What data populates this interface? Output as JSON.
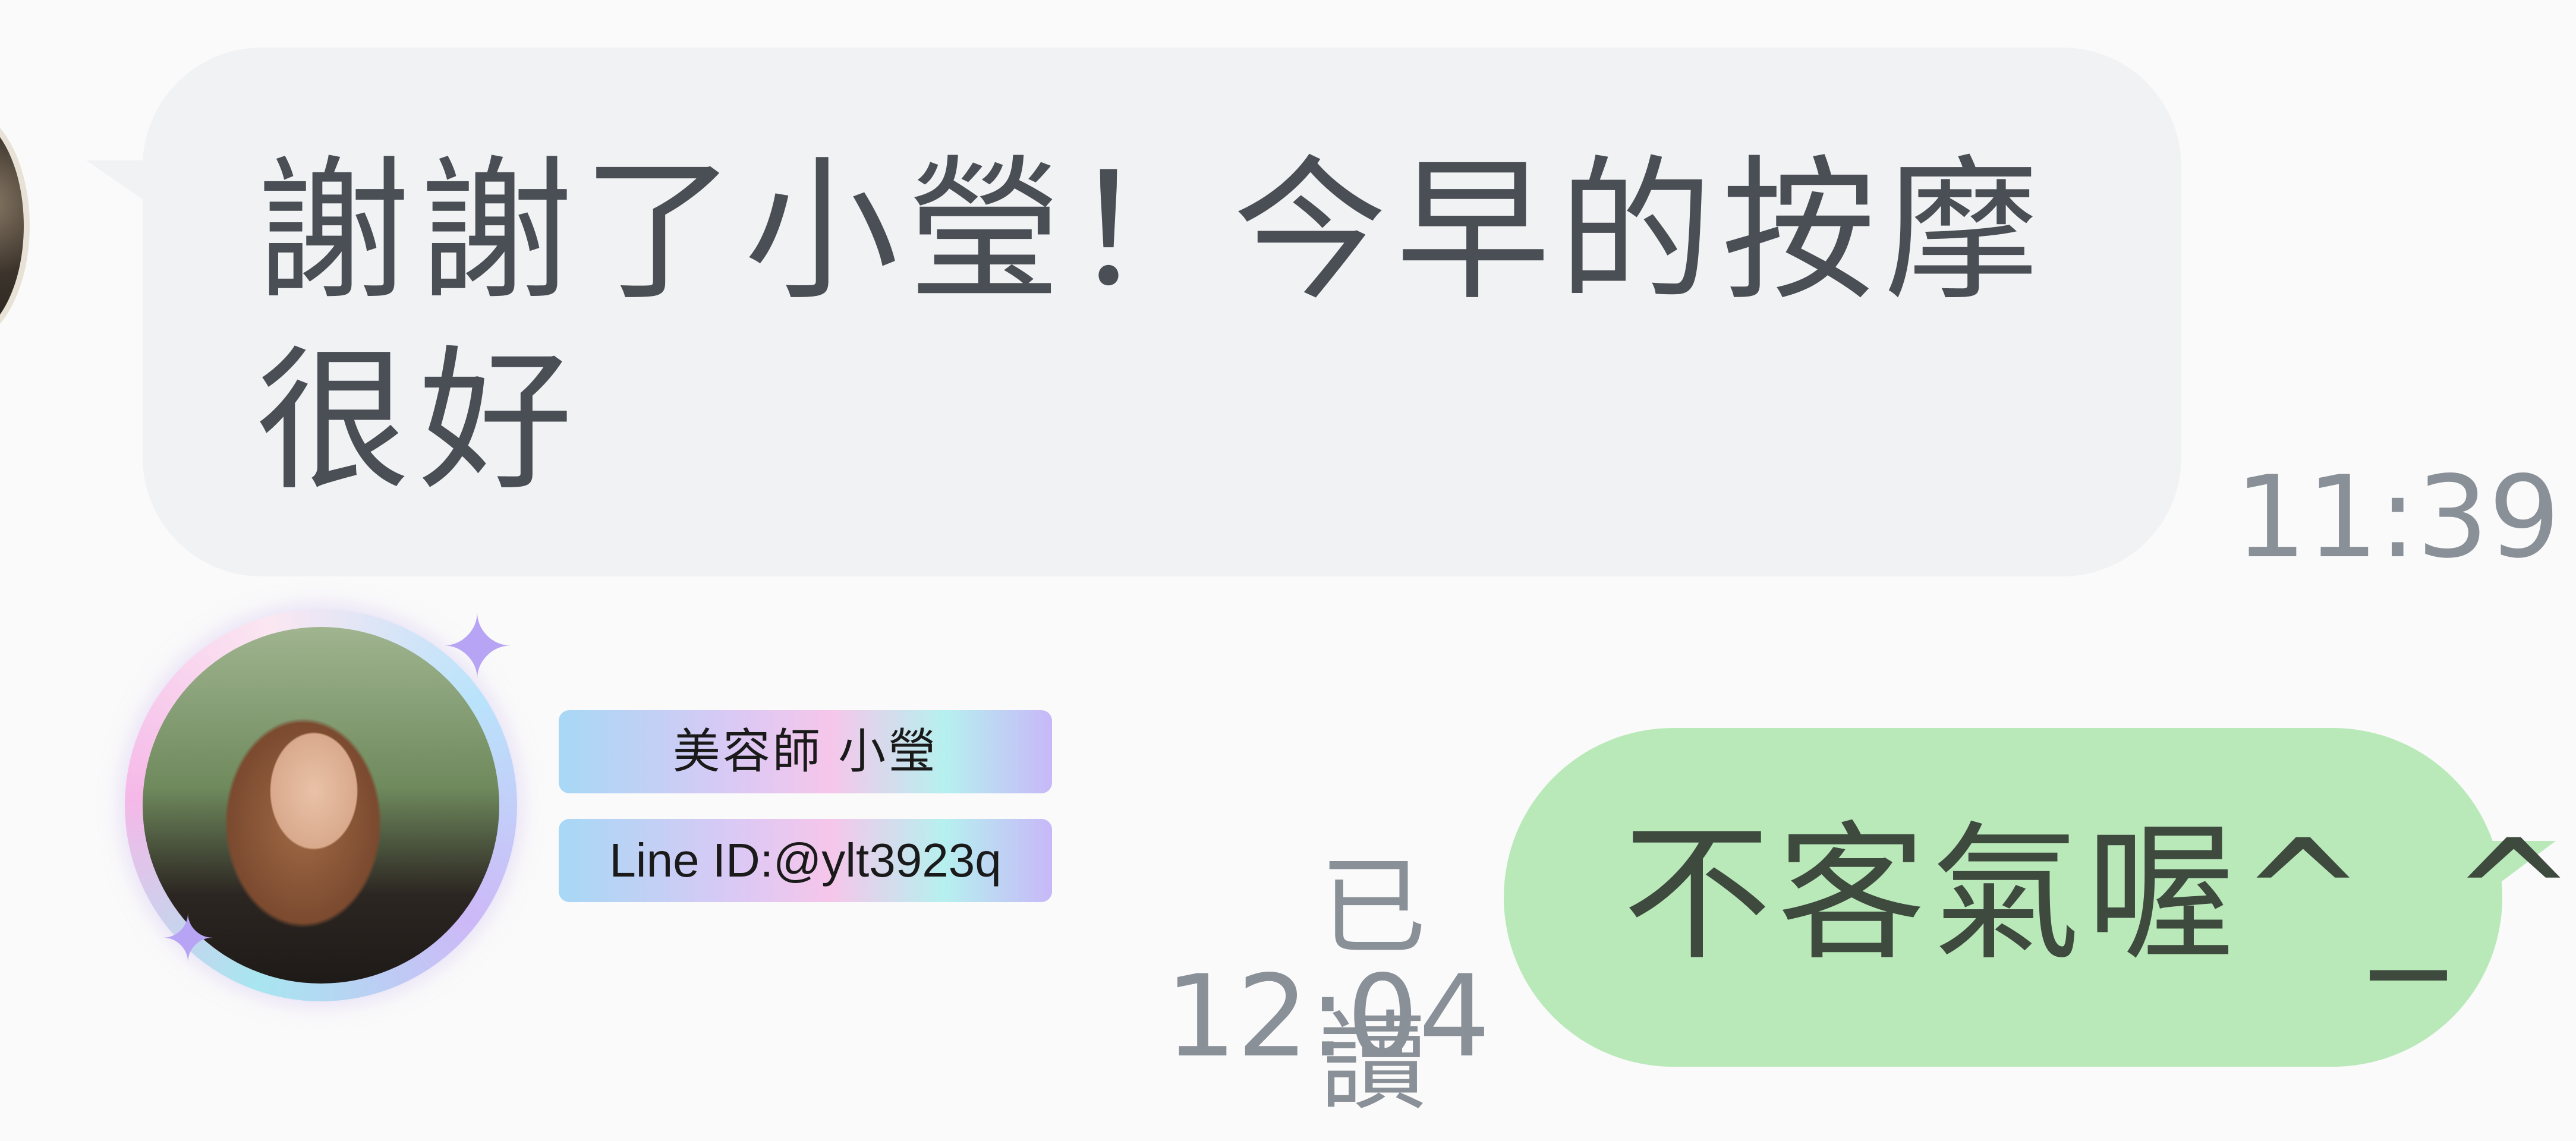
{
  "incoming": {
    "message": "謝謝了小瑩！今早的按摩很好",
    "time": "11:39"
  },
  "business_card": {
    "name_label": "美容師  小瑩",
    "line_id_label": "Line  ID:@ylt3923q"
  },
  "outgoing": {
    "message": "不客氣喔^_^",
    "read_status": "已讀",
    "time": "12:04"
  },
  "colors": {
    "incoming_bubble": "#f1f2f4",
    "outgoing_bubble": "#b9e9b9",
    "timestamp": "#8a9097",
    "background": "#fafafa"
  }
}
